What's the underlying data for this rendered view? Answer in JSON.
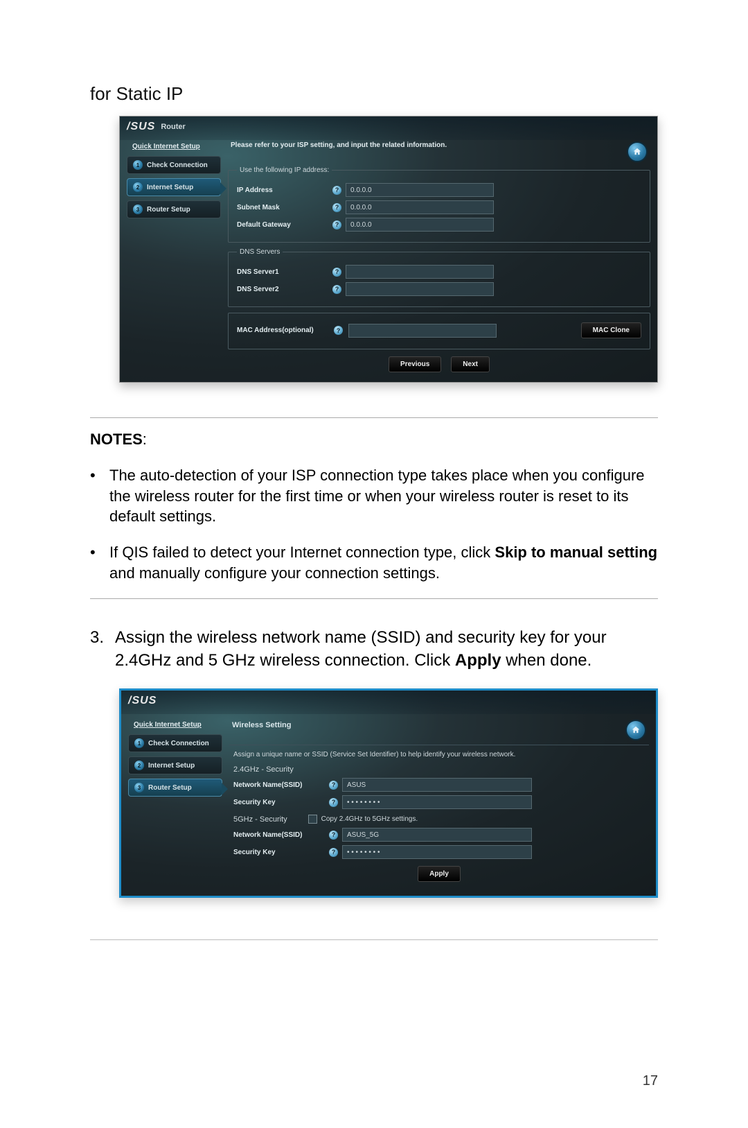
{
  "heading": "for Static IP",
  "notes_label": "NOTES",
  "notes_colon": ":",
  "bullets": [
    {
      "pre": "The auto-detection of your ISP connection type takes place when you configure the wireless router for the first time or when your wireless router is reset to its default settings."
    },
    {
      "pre": "If QIS failed to detect your Internet connection type, click ",
      "bold": "Skip to manual setting",
      "post": " and manually configure your connection settings."
    }
  ],
  "step": {
    "num": "3.",
    "pre": "Assign the wireless network name (SSID) and security key for your 2.4GHz and 5 GHz wireless connection. Click ",
    "bold": "Apply",
    "post": " when done."
  },
  "pagenum": "17",
  "ui1": {
    "brand": "/SUS",
    "brand_sub": "Router",
    "sidebar_title": "Quick Internet Setup",
    "sidebar": [
      {
        "num": "1",
        "label": "Check Connection"
      },
      {
        "num": "2",
        "label": "Internet Setup"
      },
      {
        "num": "3",
        "label": "Router Setup"
      }
    ],
    "instr": "Please refer to your ISP setting, and input the related information.",
    "fs1": "Use the following IP address:",
    "ip_label": "IP Address",
    "ip_val": "0.0.0.0",
    "sm_label": "Subnet Mask",
    "sm_val": "0.0.0.0",
    "gw_label": "Default Gateway",
    "gw_val": "0.0.0.0",
    "fs2": "DNS Servers",
    "d1_label": "DNS Server1",
    "d1_val": "",
    "d2_label": "DNS Server2",
    "d2_val": "",
    "mac_label": "MAC Address(optional)",
    "mac_val": "",
    "mac_clone": "MAC Clone",
    "prev": "Previous",
    "next": "Next"
  },
  "ui2": {
    "brand": "/SUS",
    "sidebar_title": "Quick Internet Setup",
    "sidebar": [
      {
        "num": "1",
        "label": "Check Connection"
      },
      {
        "num": "2",
        "label": "Internet Setup"
      },
      {
        "num": "3",
        "label": "Router Setup"
      }
    ],
    "panel_title": "Wireless Setting",
    "assign": "Assign a unique name or SSID (Service Set Identifier) to help identify your wireless network.",
    "g24": "2.4GHz - Security",
    "nn_label": "Network Name(SSID)",
    "nn24_val": "ASUS",
    "sk_label": "Security Key",
    "sk_val": "• • • • • • • •",
    "g5": "5GHz - Security",
    "copy": "Copy 2.4GHz to 5GHz settings.",
    "nn5_val": "ASUS_5G",
    "apply": "Apply"
  }
}
